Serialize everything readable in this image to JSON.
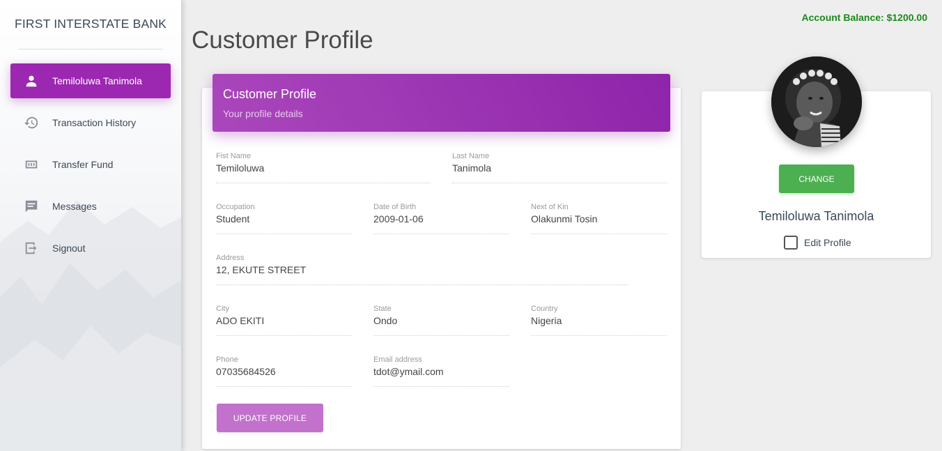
{
  "app": {
    "brand": "FIRST INTERSTATE BANK",
    "balance": "Account Balance: $1200.00"
  },
  "sidebar": {
    "items": [
      {
        "label": "Temiloluwa Tanimola",
        "icon": "person-icon",
        "active": true
      },
      {
        "label": "Transaction History",
        "icon": "history-icon",
        "active": false
      },
      {
        "label": "Transfer Fund",
        "icon": "money-icon",
        "active": false
      },
      {
        "label": "Messages",
        "icon": "message-icon",
        "active": false
      },
      {
        "label": "Signout",
        "icon": "exit-icon",
        "active": false
      }
    ]
  },
  "page": {
    "title": "Customer Profile"
  },
  "card": {
    "title": "Customer Profile",
    "subtitle": "Your profile details",
    "fields": {
      "first_name": {
        "label": "Fist Name",
        "value": "Temiloluwa"
      },
      "last_name": {
        "label": "Last Name",
        "value": "Tanimola"
      },
      "occupation": {
        "label": "Occupation",
        "value": "Student"
      },
      "dob": {
        "label": "Date of Birth",
        "value": "2009-01-06"
      },
      "next_of_kin": {
        "label": "Next of Kin",
        "value": "Olakunmi Tosin"
      },
      "address": {
        "label": "Address",
        "value": "12, EKUTE STREET"
      },
      "city": {
        "label": "City",
        "value": "ADO EKITI"
      },
      "state": {
        "label": "State",
        "value": "Ondo"
      },
      "country": {
        "label": "Country",
        "value": "Nigeria"
      },
      "phone": {
        "label": "Phone",
        "value": "07035684526"
      },
      "email": {
        "label": "Email address",
        "value": "tdot@ymail.com"
      }
    },
    "update_button": "UPDATE PROFILE"
  },
  "profile": {
    "change_button": "CHANGE",
    "name": "Temiloluwa Tanimola",
    "edit_label": "Edit Profile",
    "edit_checked": false
  },
  "colors": {
    "accent": "#9c27b0",
    "success": "#4caf50",
    "balance": "#1a8a1a"
  }
}
